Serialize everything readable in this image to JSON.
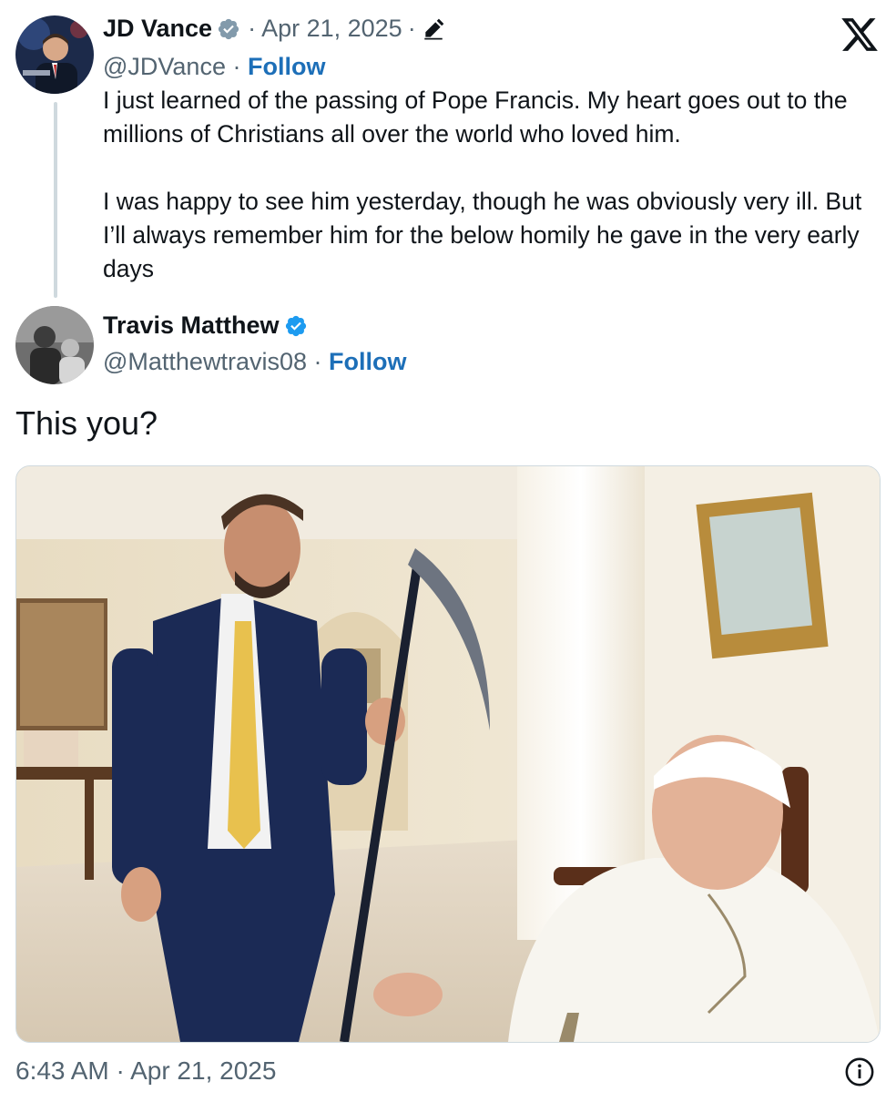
{
  "quoted_tweet": {
    "author_name": "JD Vance",
    "date": "Apr 21, 2025",
    "separator": "·",
    "handle": "@JDVance",
    "follow_label": "Follow",
    "paragraphs": [
      "I just learned of the passing of Pope Francis. My heart goes out to the millions of Christians all over the world who loved him.",
      "I was happy to see him yesterday, though he was obviously very ill. But I’ll always remember him for the below homily he gave in the very early days"
    ],
    "icons": [
      "verified-badge-icon",
      "edited-pencil-icon"
    ]
  },
  "reply_tweet": {
    "author_name": "Travis Matthew",
    "handle": "@Matthewtravis08",
    "follow_label": "Follow",
    "text": "This you?",
    "timestamp": "6:43 AM · Apr 21, 2025",
    "icons": [
      "verified-badge-icon",
      "info-icon"
    ]
  },
  "colors": {
    "text": "#0f1419",
    "secondary": "#536471",
    "link": "#1d6fb8",
    "verified": "#1d9bf0",
    "thread_line": "#cfd9de"
  },
  "brand_icon": "x-logo-icon"
}
